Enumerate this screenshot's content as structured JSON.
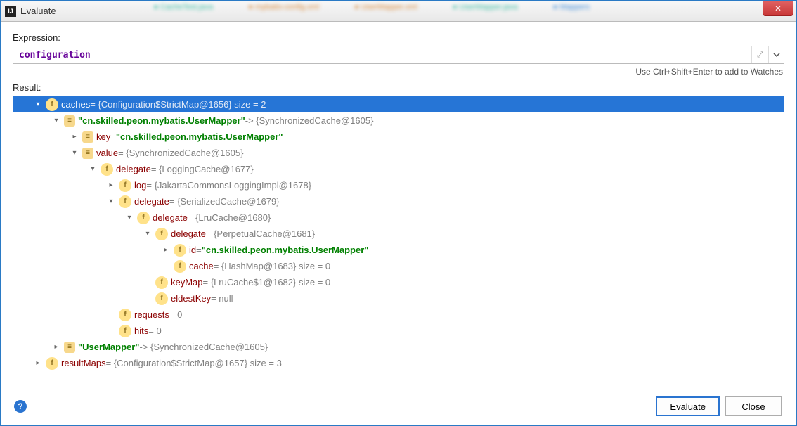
{
  "window": {
    "title": "Evaluate"
  },
  "expression": {
    "label": "Expression:",
    "value": "configuration"
  },
  "hint": "Use Ctrl+Shift+Enter to add to Watches",
  "resultLabel": "Result:",
  "footer": {
    "evaluate": "Evaluate",
    "close": "Close"
  },
  "rows": [
    {
      "indent": 28,
      "arrow": "down",
      "sel": true,
      "icon": "f",
      "key": "caches",
      "val": " = {Configuration$StrictMap@1656}  size = 2"
    },
    {
      "indent": 54,
      "arrow": "down",
      "icon": "m",
      "keyGreen": "\"cn.skilled.peon.mybatis.UserMapper\"",
      "val": " -> {SynchronizedCache@1605}"
    },
    {
      "indent": 80,
      "arrow": "right",
      "icon": "m",
      "key": "key",
      "valGreen": " = \"cn.skilled.peon.mybatis.UserMapper\""
    },
    {
      "indent": 80,
      "arrow": "down",
      "icon": "m",
      "key": "value",
      "val": " = {SynchronizedCache@1605}"
    },
    {
      "indent": 106,
      "arrow": "down",
      "icon": "f",
      "key": "delegate",
      "val": " = {LoggingCache@1677}"
    },
    {
      "indent": 132,
      "arrow": "right",
      "icon": "f",
      "key": "log",
      "val": " = {JakartaCommonsLoggingImpl@1678}"
    },
    {
      "indent": 132,
      "arrow": "down",
      "icon": "f",
      "key": "delegate",
      "val": " = {SerializedCache@1679}"
    },
    {
      "indent": 158,
      "arrow": "down",
      "icon": "f",
      "key": "delegate",
      "val": " = {LruCache@1680}"
    },
    {
      "indent": 184,
      "arrow": "down",
      "icon": "f",
      "key": "delegate",
      "val": " = {PerpetualCache@1681}"
    },
    {
      "indent": 210,
      "arrow": "right",
      "icon": "f",
      "key": "id",
      "valGreen": " = \"cn.skilled.peon.mybatis.UserMapper\""
    },
    {
      "indent": 210,
      "arrow": "none",
      "icon": "f",
      "key": "cache",
      "val": " = {HashMap@1683}  size = 0"
    },
    {
      "indent": 184,
      "arrow": "none",
      "icon": "f",
      "key": "keyMap",
      "val": " = {LruCache$1@1682}  size = 0"
    },
    {
      "indent": 184,
      "arrow": "none",
      "icon": "f",
      "key": "eldestKey",
      "val": " = null"
    },
    {
      "indent": 132,
      "arrow": "none",
      "icon": "f",
      "key": "requests",
      "val": " = 0"
    },
    {
      "indent": 132,
      "arrow": "none",
      "icon": "f",
      "key": "hits",
      "val": " = 0"
    },
    {
      "indent": 54,
      "arrow": "right",
      "icon": "m",
      "keyGreen": "\"UserMapper\"",
      "val": " -> {SynchronizedCache@1605}"
    },
    {
      "indent": 28,
      "arrow": "right",
      "icon": "f",
      "key": "resultMaps",
      "val": " = {Configuration$StrictMap@1657}  size = 3"
    }
  ]
}
